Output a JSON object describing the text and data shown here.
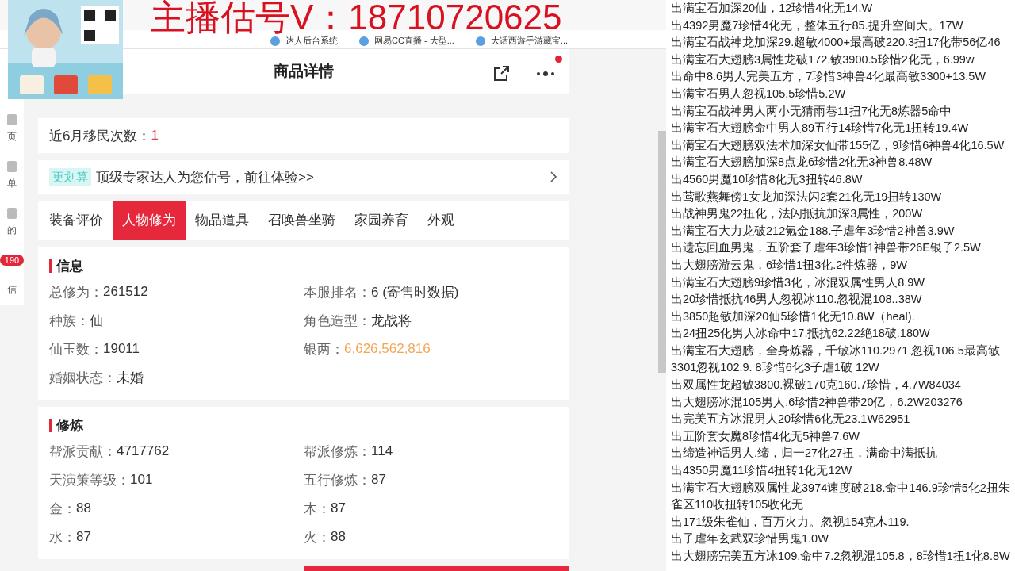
{
  "overlay": {
    "text": "主播估号V：18710720625"
  },
  "bookmarks": [
    {
      "label": "达人后台系统"
    },
    {
      "label": "网易CC直播 - 大型..."
    },
    {
      "label": "大话西游手游藏宝..."
    }
  ],
  "sidebar": {
    "items": [
      {
        "label": "页"
      },
      {
        "label": "单"
      },
      {
        "label": "的"
      }
    ],
    "badge": "190",
    "last_label": "信"
  },
  "header": {
    "title": "商品详情",
    "menu_dot": true
  },
  "migration": {
    "label": "近6月移民次数：",
    "value": "1"
  },
  "promo": {
    "tag": "更划算",
    "text": "顶级专家达人为您估号，前往体验>>"
  },
  "tabs": [
    {
      "label": "装备评价",
      "selected": false
    },
    {
      "label": "人物修为",
      "selected": true
    },
    {
      "label": "物品道具",
      "selected": false
    },
    {
      "label": "召唤兽坐骑",
      "selected": false
    },
    {
      "label": "家园养育",
      "selected": false
    },
    {
      "label": "外观",
      "selected": false
    }
  ],
  "sections": [
    {
      "title": "信息",
      "fields": [
        {
          "label": "总修为：",
          "value": "261512"
        },
        {
          "label": "本服排名：",
          "value": "6 (寄售时数据)"
        },
        {
          "label": "种族：",
          "value": "仙"
        },
        {
          "label": "角色造型：",
          "value": "龙战将"
        },
        {
          "label": "仙玉数：",
          "value": "19011"
        },
        {
          "label": "银两：",
          "value": "6,626,562,816",
          "highlight": true
        },
        {
          "label": "婚姻状态：",
          "value": "未婚"
        }
      ]
    },
    {
      "title": "修炼",
      "fields": [
        {
          "label": "帮派贡献：",
          "value": "4717762"
        },
        {
          "label": "帮派修炼：",
          "value": "114"
        },
        {
          "label": "天演策等级：",
          "value": "101"
        },
        {
          "label": "五行修炼：",
          "value": "87"
        },
        {
          "label": "金：",
          "value": "88"
        },
        {
          "label": "木：",
          "value": "87"
        },
        {
          "label": "水：",
          "value": "87"
        },
        {
          "label": "火：",
          "value": "88"
        }
      ]
    }
  ],
  "listings": [
    "出满宝石加深20仙，12珍惜4化无14.W",
    "出4392男魔7珍惜4化无，整体五行85.提升空间大。17W",
    "出满宝石战神龙加深29.超敏4000+最高破220.3扭17化带56亿46",
    "出满宝石大翅膀3属性龙破172.敏3900.5珍惜2化无，6.99w",
    "出命中8.6男人完美五方，7珍惜3神兽4化最高敏3300+13.5W",
    "出满宝石男人忽视105.5珍惜5.2W",
    "出满宝石战神男人两小无猜雨巷11扭7化无8炼器5命中",
    "出满宝石大翅膀命中男人89五行14珍惜7化无1扭转19.4W",
    "出满宝石大翅膀双法术加深女仙带155亿，9珍惜6神兽4化16.5W",
    "出满宝石大翅膀加深8点龙6珍惜2化无3神兽8.48W",
    "出4560男魔10珍惜8化无3扭转46.8W",
    "出莺歌燕舞傍1女龙加深法闪2套21化无19扭转130W",
    "出战神男鬼22扭化，法闪抵抗加深3属性，200W",
    "出满宝石大力龙破212氪金188.子虐年3珍惜2神兽3.9W",
    "出遗忘回血男鬼，五阶套子虐年3珍惜1神兽带26E银子2.5W",
    "出大翅膀游云鬼，6珍惜1扭3化.2件炼器，9W",
    "出满宝石大翅膀9珍惜3化，冰混双属性男人8.9W",
    "出20珍惜抵抗46男人忽视冰110.忽视混108..38W",
    "出3850超敏加深20仙5珍惜1化无10.8W（heal).",
    "出24扭25化男人冰命中17.抵抗62.22绝18破.180W",
    "出满宝石大翅膀，全身炼器，千敏冰110.2971.忽视106.5最高敏3301忽视102.9. 8珍惜6化3子虐1破  12W",
    "出双属性龙超敏3800.裸破170克160.7珍惜，4.7W84034",
    "出大翅膀冰混105男人.6珍惜2神兽带20亿，6.2W203276",
    "出完美五方冰混男人20珍惜6化无23.1W62951",
    "出五阶套女魔8珍惜4化无5神兽7.6W",
    "出缔造神话男人.缔，归一27化27扭，满命中满抵抗",
    "出4350男魔11珍惜4扭转1化无12W",
    "出满宝石大翅膀双属性龙3974速度破218.命中146.9珍惜5化2扭朱雀区110收扭转105收化无",
    "出171级朱雀仙，百万火力。忽视154克木119.",
    "出子虐年玄武双珍惜男鬼1.0W",
    "出大翅膀完美五方冰109.命中7.2忽视混105.8，8珍惜1扭1化8.8W"
  ]
}
